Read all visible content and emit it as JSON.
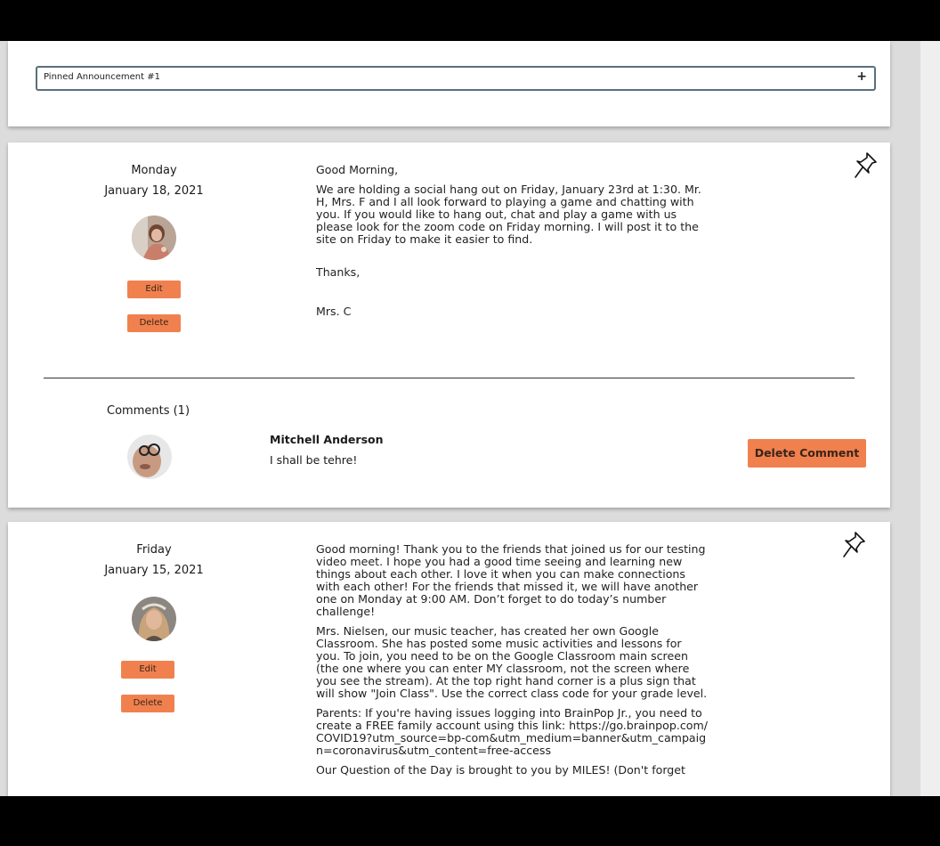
{
  "pinned": {
    "label": "Pinned Announcement #1",
    "toggle": "+"
  },
  "posts": [
    {
      "day": "Monday",
      "date": "January 18, 2021",
      "edit_label": "Edit",
      "delete_label": "Delete",
      "paragraphs": [
        "Good Morning,",
        "We are holding a social hang out on Friday, January 23rd at 1:30. Mr. H, Mrs. F and I all look forward to playing a game and chatting with you.  If you would like to hang out, chat and play a game with us please look for the zoom code on Friday morning.  I will post it to the site on Friday to make it easier to find.",
        "Thanks,",
        "Mrs. C"
      ],
      "comments_title": "Comments (1)",
      "comment": {
        "author": "Mitchell Anderson",
        "text": "I shall be tehre!",
        "delete_label": "Delete Comment"
      }
    },
    {
      "day": "Friday",
      "date": "January 15, 2021",
      "edit_label": "Edit",
      "delete_label": "Delete",
      "paragraphs": [
        "Good morning! Thank you to the friends that joined us for our testing video meet. I hope you had a good time seeing and learning new things about each other. I love it when you can make connections with each other! For the friends that missed it, we will have another one on Monday at 9:00 AM. Don’t forget to do today’s number challenge!",
        "Mrs. Nielsen, our music teacher, has created her own Google Classroom. She has posted some music activities and lessons for you. To join, you need to be on the Google Classroom main screen (the one where you can enter MY classroom, not the screen where you see the stream). At the top right hand corner is a plus sign that will show \"Join Class\". Use the correct class code for your grade level.",
        "Parents: If you're having issues logging into BrainPop Jr., you need to create a FREE family account using this link: https://go.brainpop.com/COVID19?utm_source=bp-com&utm_medium=banner&utm_campaign=coronavirus&utm_content=free-access",
        "Our Question of the Day is brought to you by MILES! (Don't forget"
      ]
    }
  ],
  "colors": {
    "accent": "#f0814f",
    "background": "#dcdcdc"
  }
}
